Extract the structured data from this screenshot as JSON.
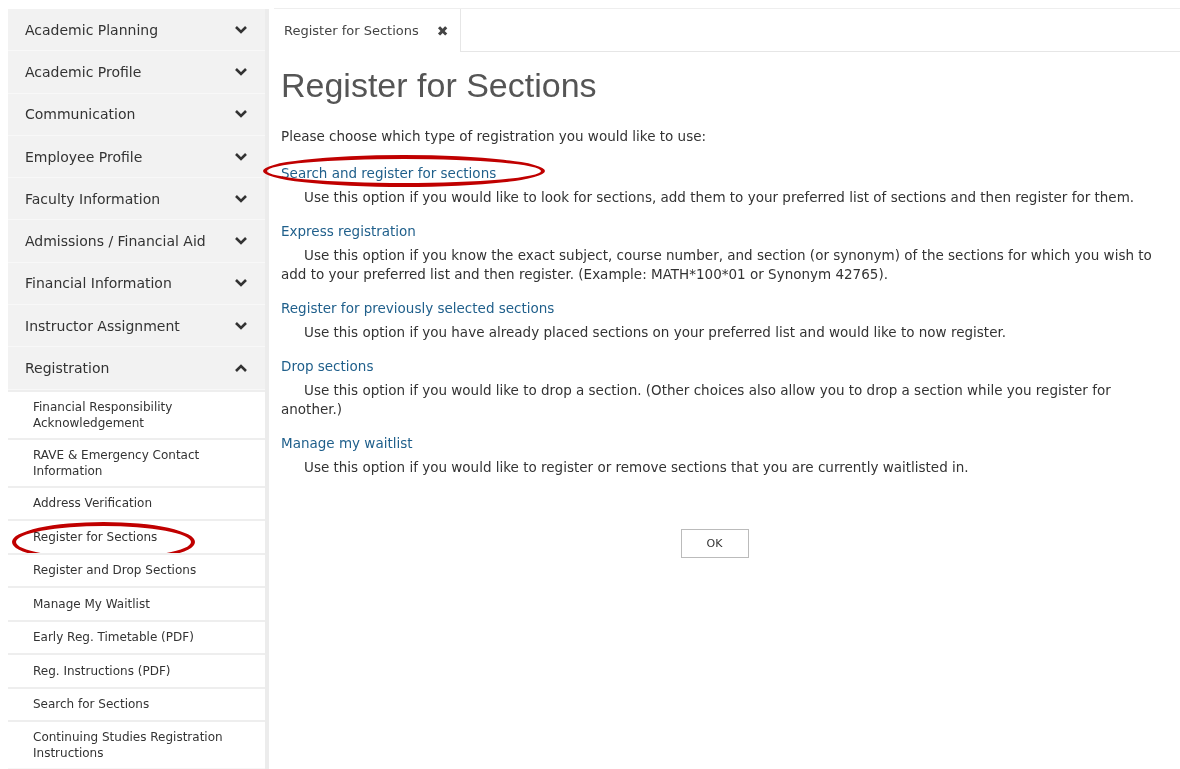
{
  "sidebar": {
    "items": [
      {
        "label": "Academic Planning",
        "expanded": false
      },
      {
        "label": "Academic Profile",
        "expanded": false
      },
      {
        "label": "Communication",
        "expanded": false
      },
      {
        "label": "Employee Profile",
        "expanded": false
      },
      {
        "label": "Faculty Information",
        "expanded": false
      },
      {
        "label": "Admissions / Financial Aid",
        "expanded": false
      },
      {
        "label": "Financial Information",
        "expanded": false
      },
      {
        "label": "Instructor Assignment",
        "expanded": false
      },
      {
        "label": "Registration",
        "expanded": true,
        "children": [
          {
            "label": "Financial Responsibility Acknowledgement",
            "circled": false
          },
          {
            "label": "RAVE & Emergency Contact Information",
            "circled": false
          },
          {
            "label": "Address Verification",
            "circled": false
          },
          {
            "label": "Register for Sections",
            "circled": true
          },
          {
            "label": "Register and Drop Sections",
            "circled": false
          },
          {
            "label": "Manage My Waitlist",
            "circled": false
          },
          {
            "label": "Early Reg. Timetable (PDF)",
            "circled": false
          },
          {
            "label": "Reg. Instructions (PDF)",
            "circled": false
          },
          {
            "label": "Search for Sections",
            "circled": false
          },
          {
            "label": "Continuing Studies Registration Instructions",
            "circled": false
          }
        ]
      }
    ]
  },
  "tabs": [
    {
      "label": "Register for Sections",
      "close": "✖",
      "selected": true
    }
  ],
  "title": "Register for Sections",
  "intro": "Please choose which type of registration you would like to use:",
  "options": [
    {
      "link": "Search and register for sections",
      "circled": true,
      "description": "Use this option if you would like to look for sections, add them to your preferred list of sections and then register for them."
    },
    {
      "link": "Express registration",
      "circled": false,
      "description": "Use this option if you know the exact subject, course number, and section (or synonym) of the sections for which you wish to add to your preferred list and then register. (Example: MATH*100*01 or Synonym 42765)."
    },
    {
      "link": "Register for previously selected sections",
      "circled": false,
      "description": "Use this option if you have already placed sections on your preferred list and would like to now register."
    },
    {
      "link": "Drop sections",
      "circled": false,
      "description": "Use this option if you would like to drop a section. (Other choices also allow you to drop a section while you register for another.)"
    },
    {
      "link": "Manage my waitlist",
      "circled": false,
      "description": "Use this option if you would like to register or remove sections that you are currently waitlisted in."
    }
  ],
  "ok_button": "OK"
}
